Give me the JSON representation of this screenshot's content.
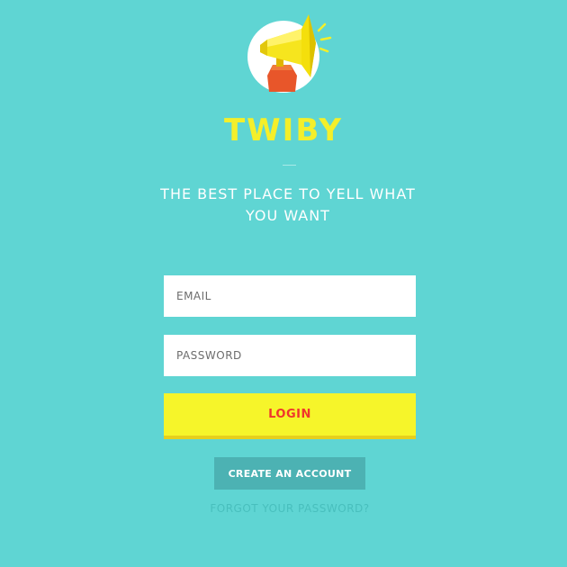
{
  "brand": {
    "name": "TWIBY",
    "tagline": "THE BEST PLACE TO YELL WHAT YOU WANT",
    "logo_icon": "megaphone-icon"
  },
  "form": {
    "email_placeholder": "EMAIL",
    "password_placeholder": "PASSWORD",
    "login_label": "LOGIN",
    "create_account_label": "CREATE AN ACCOUNT",
    "forgot_password_label": "FORGOT YOUR PASSWORD?"
  },
  "colors": {
    "background": "#5fd5d3",
    "brand_yellow": "#f4ef2a",
    "login_bg": "#f6f52a",
    "login_text": "#f0362c",
    "secondary_button": "#4cb2b3",
    "link": "#48bfbd"
  }
}
